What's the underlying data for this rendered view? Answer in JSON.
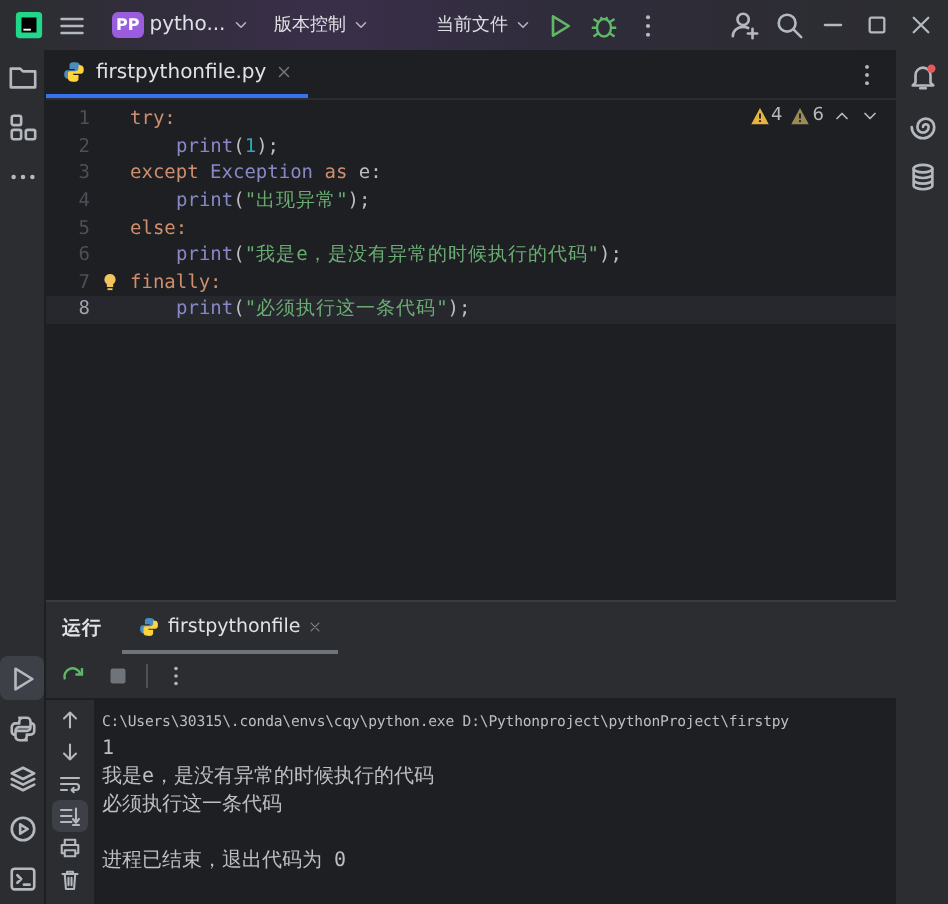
{
  "title_bar": {
    "project_badge": "PP",
    "project": "pytho...",
    "vcs": "版本控制",
    "run_config": "当前文件"
  },
  "left_toolbar_top": [
    {
      "kind": "folder",
      "selected": false
    },
    {
      "kind": "structure",
      "selected": false
    },
    {
      "kind": "more",
      "selected": false
    }
  ],
  "left_toolbar_bottom": [
    {
      "kind": "run",
      "selected": true
    },
    {
      "kind": "python",
      "selected": false
    },
    {
      "kind": "layers",
      "selected": false
    },
    {
      "kind": "services",
      "selected": false
    },
    {
      "kind": "terminal",
      "selected": false
    }
  ],
  "editor_tabs": [
    {
      "label": "firstpythonfile.py",
      "selected": true
    }
  ],
  "inspections": {
    "warnings": "4",
    "weak_warnings": "6"
  },
  "code_lines": [
    {
      "number": "1",
      "current": false,
      "indent": false,
      "tokens": [
        {
          "text": "try:",
          "kind": "keyword"
        }
      ]
    },
    {
      "number": "2",
      "current": false,
      "indent": true,
      "tokens": [
        {
          "text": "print",
          "kind": "builtin"
        },
        {
          "text": "(",
          "kind": "plain"
        },
        {
          "text": "1",
          "kind": "number"
        },
        {
          "text": ");",
          "kind": "plain"
        }
      ]
    },
    {
      "number": "3",
      "current": false,
      "indent": false,
      "tokens": [
        {
          "text": "except ",
          "kind": "keyword"
        },
        {
          "text": "Exception",
          "kind": "builtin"
        },
        {
          "text": " as ",
          "kind": "keyword"
        },
        {
          "text": "e:",
          "kind": "plain"
        }
      ]
    },
    {
      "number": "4",
      "current": false,
      "indent": true,
      "tokens": [
        {
          "text": "print",
          "kind": "builtin"
        },
        {
          "text": "(",
          "kind": "plain"
        },
        {
          "text": "\"出现异常\"",
          "kind": "string"
        },
        {
          "text": ");",
          "kind": "plain"
        }
      ]
    },
    {
      "number": "5",
      "current": false,
      "indent": false,
      "tokens": [
        {
          "text": "else:",
          "kind": "keyword"
        }
      ]
    },
    {
      "number": "6",
      "current": false,
      "indent": true,
      "tokens": [
        {
          "text": "print",
          "kind": "builtin"
        },
        {
          "text": "(",
          "kind": "plain"
        },
        {
          "text": "\"我是e，是没有异常的时候执行的代码\"",
          "kind": "string"
        },
        {
          "text": ");",
          "kind": "plain"
        }
      ]
    },
    {
      "number": "7",
      "current": false,
      "indent": false,
      "bulb": true,
      "tokens": [
        {
          "text": "finally:",
          "kind": "keyword"
        }
      ]
    },
    {
      "number": "8",
      "current": true,
      "indent": true,
      "tokens": [
        {
          "text": "print",
          "kind": "builtin"
        },
        {
          "text": "(",
          "kind": "plain"
        },
        {
          "text": "\"必须执行这一条代码\"",
          "kind": "string"
        },
        {
          "text": ");",
          "kind": "plain"
        }
      ]
    }
  ],
  "run_panel": {
    "title": "运行",
    "tabs": [
      {
        "label": "firstpythonfile",
        "selected": true
      }
    ],
    "side_tools": [
      {
        "kind": "up",
        "selected": false
      },
      {
        "kind": "down",
        "selected": false
      },
      {
        "kind": "wrap",
        "selected": false
      },
      {
        "kind": "scroll-end",
        "selected": true
      },
      {
        "kind": "print",
        "selected": false
      },
      {
        "kind": "trash",
        "selected": false
      }
    ],
    "console": [
      {
        "text": "C:\\Users\\30315\\.conda\\envs\\cqy\\python.exe D:\\Pythonproject\\pythonProject\\firstpy",
        "kind": "command"
      },
      {
        "text": "1",
        "kind": "output"
      },
      {
        "text": "我是e，是没有异常的时候执行的代码",
        "kind": "output"
      },
      {
        "text": "必须执行这一条代码",
        "kind": "output"
      },
      {
        "text": "进程已结束，退出代码为 0",
        "kind": "status"
      }
    ]
  }
}
